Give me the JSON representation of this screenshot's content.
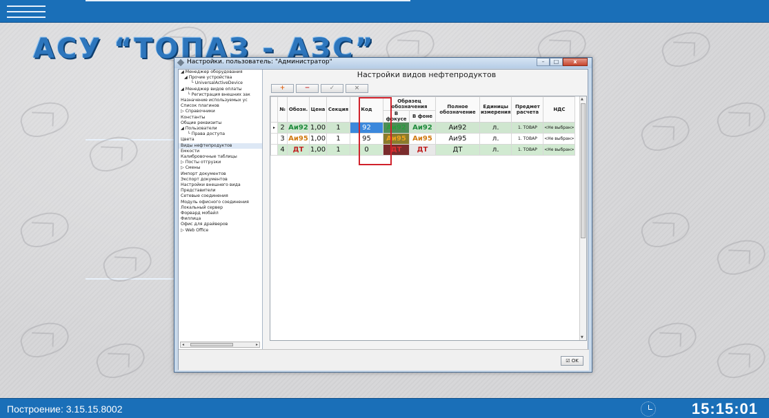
{
  "header": {
    "brand": "АСУ “ТОПАЗ - АЗС”"
  },
  "window": {
    "title": "Настройки. пользователь: \"Администратор\"",
    "panel_title": "Настройки видов нефтепродуктов",
    "buttons": {
      "minimize": "–",
      "maximize": "□",
      "close": "x"
    }
  },
  "toolbar": {
    "add": "+",
    "delete": "−",
    "save": "✓",
    "cancel": "×"
  },
  "tree": [
    {
      "label": "◢ Менеджер оборудования",
      "indent": 0
    },
    {
      "label": "◢ Прочие устройства",
      "indent": 1
    },
    {
      "label": "└ UniversalActiveDevice",
      "indent": 3
    },
    {
      "label": "◢ Менеджер видов оплаты",
      "indent": 0
    },
    {
      "label": "└ Регистрация внешних зак",
      "indent": 2
    },
    {
      "label": "Назначение используемых ус",
      "indent": 0
    },
    {
      "label": "Список плагинов",
      "indent": 0
    },
    {
      "label": "▷ Справочники",
      "indent": 0
    },
    {
      "label": "Константы",
      "indent": 0
    },
    {
      "label": "Общие реквизиты",
      "indent": 0
    },
    {
      "label": "◢ Пользователи",
      "indent": 0
    },
    {
      "label": "└ Права доступа",
      "indent": 2
    },
    {
      "label": "Цвета",
      "indent": 0
    },
    {
      "label": "Виды нефтепродуктов",
      "indent": 0,
      "selected": true
    },
    {
      "label": "Емкости",
      "indent": 0
    },
    {
      "label": "Калибровочные таблицы",
      "indent": 0
    },
    {
      "label": "▷ Посты отгрузки",
      "indent": 0
    },
    {
      "label": "▷ Смены",
      "indent": 0
    },
    {
      "label": "Импорт документов",
      "indent": 0
    },
    {
      "label": "Экспорт документов",
      "indent": 0
    },
    {
      "label": "Настройки внешнего вида",
      "indent": 0
    },
    {
      "label": "Представители",
      "indent": 0
    },
    {
      "label": "Сетевые соединения",
      "indent": 0
    },
    {
      "label": "Модуль офисного соединения",
      "indent": 0
    },
    {
      "label": "Локальный сервер",
      "indent": 0
    },
    {
      "label": "Форвард мобайл",
      "indent": 0
    },
    {
      "label": "Филлица",
      "indent": 0
    },
    {
      "label": "Офис для драйверов",
      "indent": 0
    },
    {
      "label": "▷ Web Office",
      "indent": 0
    }
  ],
  "table": {
    "headers": {
      "num": "№",
      "abbr": "Обозн.",
      "price": "Цена",
      "section": "Секция",
      "code": "Код",
      "sample": "Образец обозначения",
      "in_focus": "В фокусе",
      "in_bg": "В фоне",
      "full": "Полное обозначение",
      "units": "Единицы измерения",
      "subject": "Предмет расчета",
      "vat": "НДС"
    },
    "rows": [
      {
        "pointer": "▸",
        "num": "2",
        "abbr": "Аи92",
        "price": "1,00",
        "section": "1",
        "code": "92",
        "focus": "Аи92",
        "bg": "Аи92",
        "full": "Аи92",
        "units": "л.",
        "subject": "1. ТОВАР",
        "vat": "<Не выбран>"
      },
      {
        "pointer": "",
        "num": "3",
        "abbr": "Аи95",
        "price": "1,00",
        "section": "1",
        "code": "95",
        "focus": "Аи95",
        "bg": "Аи95",
        "full": "Аи95",
        "units": "л.",
        "subject": "1. ТОВАР",
        "vat": "<Не выбран>"
      },
      {
        "pointer": "",
        "num": "4",
        "abbr": "ДТ",
        "price": "1,00",
        "section": "1",
        "code": "0",
        "focus": "ДТ",
        "bg": "ДТ",
        "full": "ДТ",
        "units": "л.",
        "subject": "1. ТОВАР",
        "vat": "<Не выбран>"
      }
    ]
  },
  "footer": {
    "ok": "☑ OK"
  },
  "statusbar": {
    "build": "Построение: 3.15.15.8002",
    "time": "15:15:01"
  },
  "colors": {
    "bar": "#1a6fb8",
    "code_highlight": "#d0202a",
    "selected_cell": "#3b88dc"
  }
}
